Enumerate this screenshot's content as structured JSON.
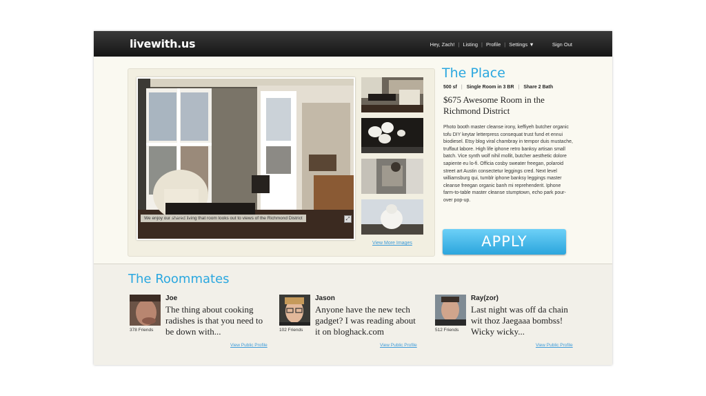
{
  "header": {
    "logo": "livewith.us",
    "greeting": "Hey, Zach!",
    "nav": [
      "Listing",
      "Profile",
      "Settings ▼"
    ],
    "signout": "Sign Out"
  },
  "gallery": {
    "caption": "We enjoy our shared living that room looks out to views of the Richmond District",
    "view_more": "View More Images",
    "expand_icon": "expand-icon"
  },
  "place": {
    "title": "The Place",
    "specs": [
      "500 sf",
      "Single Room in 3 BR",
      "Share 2 Bath"
    ],
    "listing_title": "$675 Awesome Room in the Richmond District",
    "description": "Photo booth master cleanse irony, keffiyeh butcher organic tofu DIY keytar letterpress consequat trust fund et ennui biodiesel. Etsy blog viral chambray in tempor duis mustache, truffaut labore. High life iphone retro banksy artisan small batch. Vice synth wolf nihil mollit, butcher aesthetic dolore sapiente eu lo-fi. Officia cosby sweater freegan, polaroid street art Austin consectetur leggings cred. Next level williamsburg qui, tumblr iphone banksy leggings master cleanse freegan organic banh mi reprehenderit. Iphone farm-to-table master cleanse stumptown, echo park pour-over pop-up.",
    "apply_label": "APPLY"
  },
  "roommates": {
    "title": "The Roommates",
    "people": [
      {
        "name": "Joe",
        "quote": "The thing about cooking radishes is that you need to be down with...",
        "friends": "378 Friends",
        "profile_link": "View Public Profile"
      },
      {
        "name": "Jason",
        "quote": "Anyone have the new tech gadget? I was reading about it on bloghack.com",
        "friends": "102 Friends",
        "profile_link": "View Public Profile"
      },
      {
        "name": "Ray(zor)",
        "quote": "Last night was off da chain wit thoz Jaegaaa bombss! Wicky wicky...",
        "friends": "512 Friends",
        "profile_link": "View Public Profile"
      }
    ]
  },
  "colors": {
    "accent": "#2aa7df",
    "link": "#3a9ad9",
    "topbar": "#1e1e1e"
  }
}
